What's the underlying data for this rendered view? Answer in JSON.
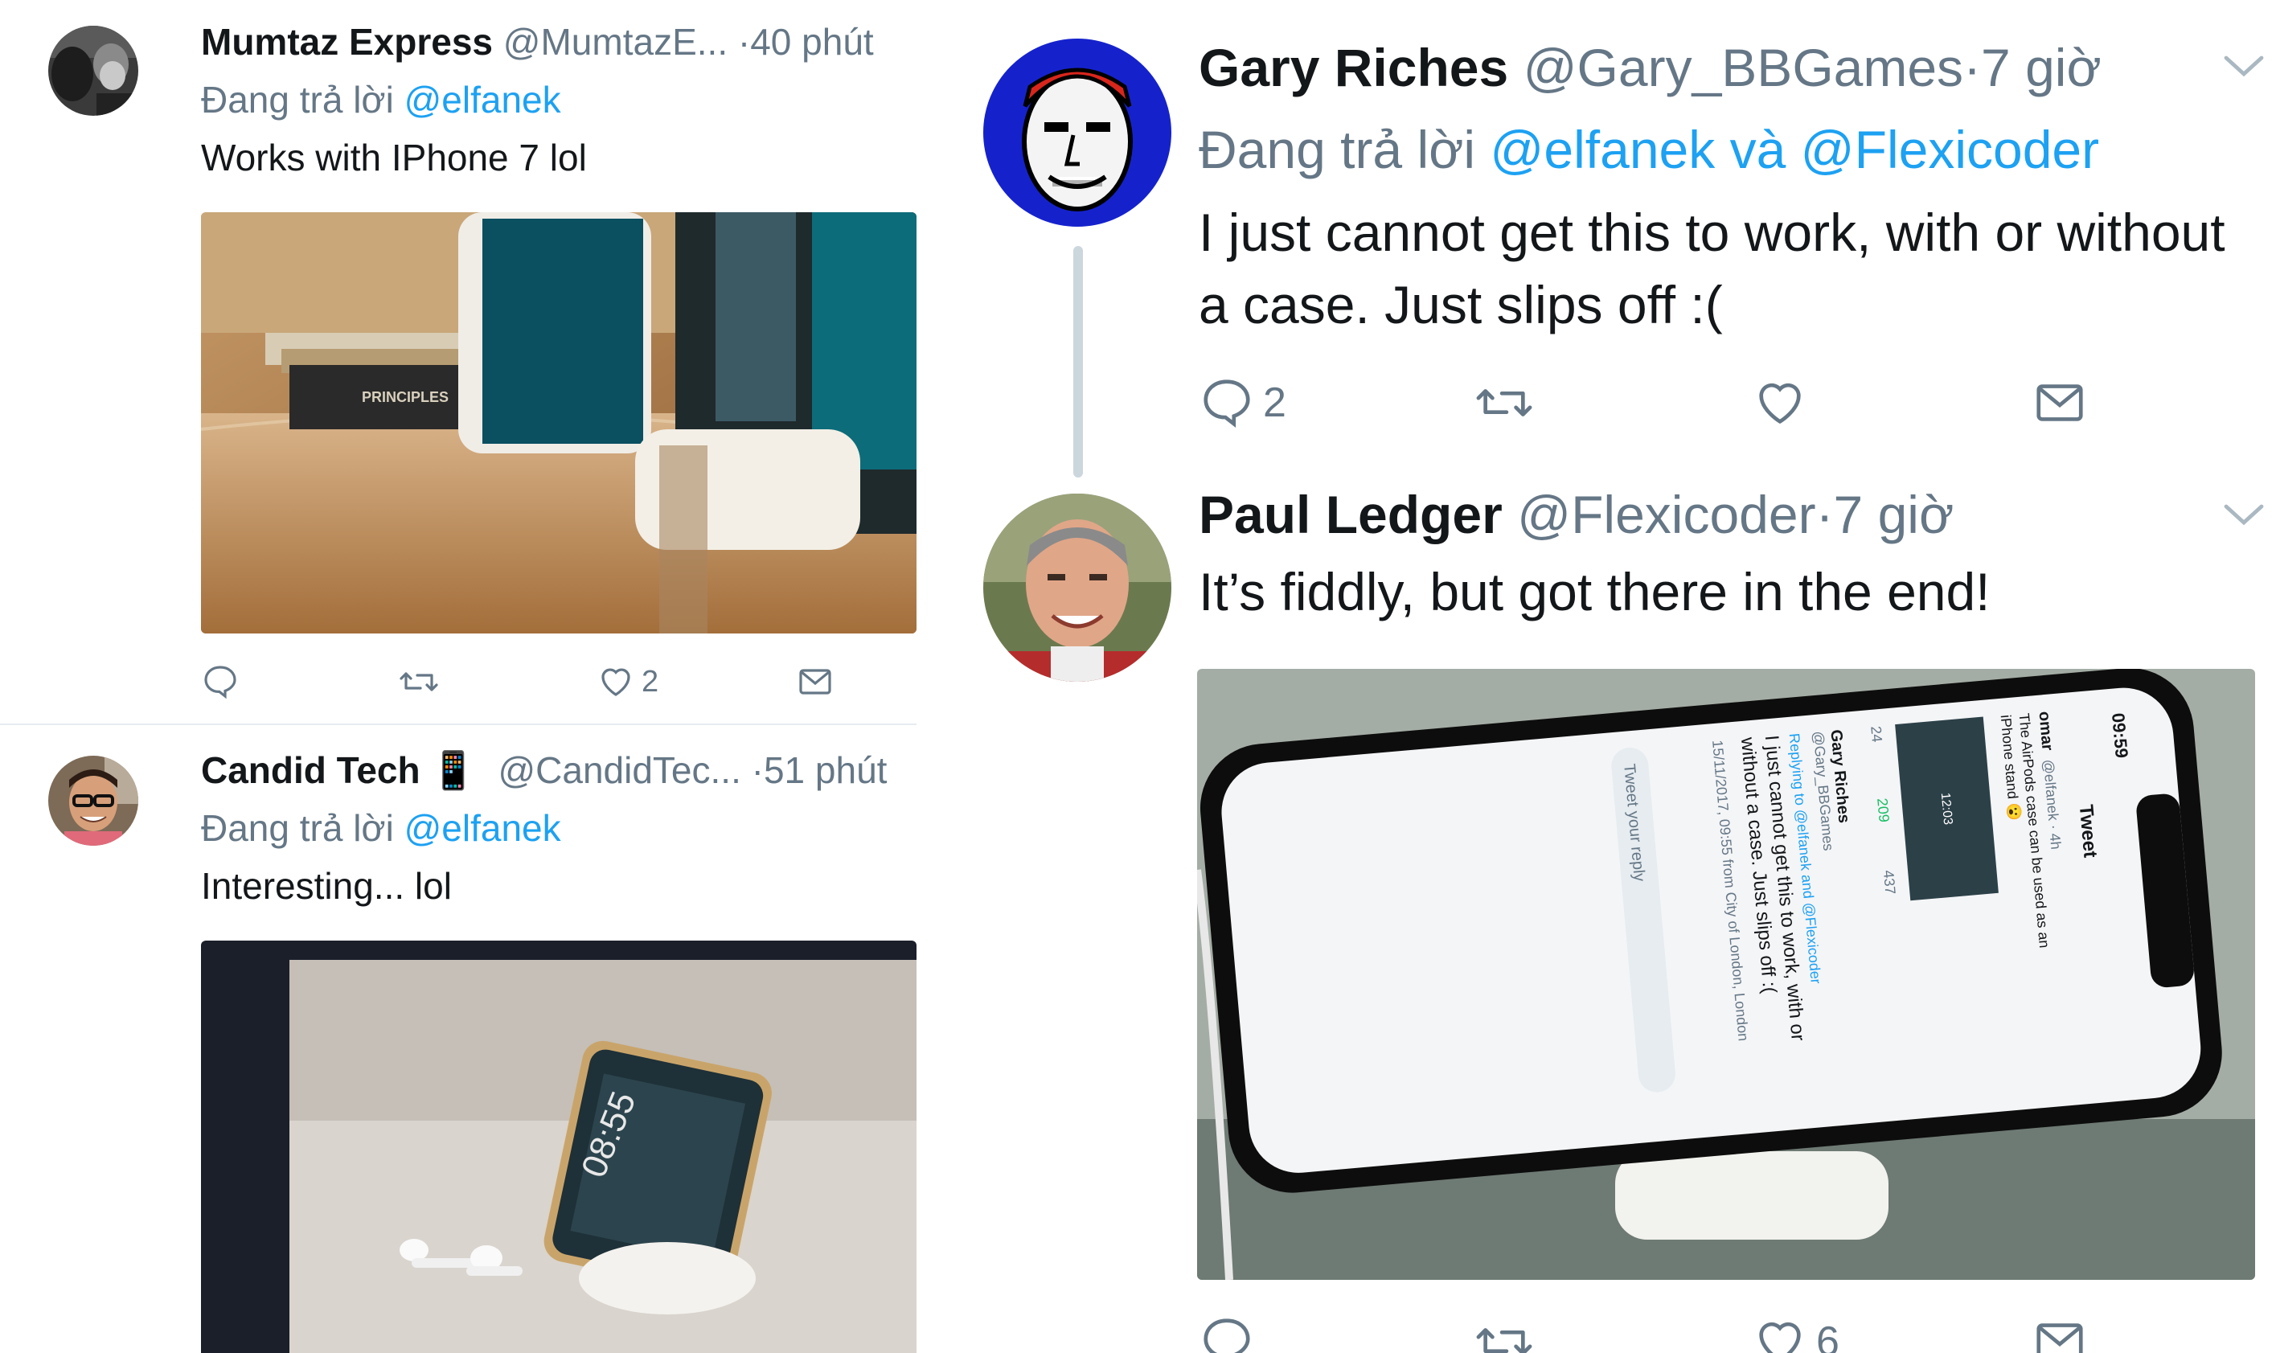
{
  "left_feed": {
    "tweets": [
      {
        "name": "Mumtaz Express",
        "handle": "@MumtazE...",
        "separator": "·",
        "time": "40 phút",
        "replying_prefix": "Đang trả lời ",
        "replying_to": "@elfanek",
        "text": "Works with IPhone 7 lol",
        "media_alt": "iPhone 7 standing on AirPods case next to books",
        "book_title": "PRINCIPLES",
        "actions": {
          "reply_count": "",
          "retweet_count": "",
          "like_count": "2"
        }
      },
      {
        "name": "Candid Tech",
        "name_emoji": "📱",
        "handle": "@CandidTec...",
        "separator": "·",
        "time": "51 phút",
        "replying_prefix": "Đang trả lời ",
        "replying_to": "@elfanek",
        "text": "Interesting... lol",
        "media_alt": "iPhone X standing on AirPods case with AirPods on table",
        "phone_clock": "08:55"
      }
    ]
  },
  "right_thread": {
    "tweets": [
      {
        "name": "Gary Riches",
        "handle": "@Gary_BBGames",
        "separator": "·",
        "time": "7 giờ",
        "replying_prefix": "Đang trả lời ",
        "replying_to_1": "@elfanek",
        "replying_and": " và ",
        "replying_to_2": "@Flexicoder",
        "text": "I just cannot get this to work, with or without a case. Just slips off :(",
        "actions": {
          "reply_count": "2",
          "retweet_count": "",
          "like_count": ""
        }
      },
      {
        "name": "Paul Ledger",
        "handle": "@Flexicoder",
        "separator": "·",
        "time": "7 giờ",
        "text": "It’s fiddly, but got there in the end!",
        "media_alt": "iPhone X on AirPods case showing tweet screen",
        "screen": {
          "status_time": "09:59",
          "title": "Tweet",
          "omar_name": "omar",
          "omar_handle": "@elfanek · 4h",
          "omar_text_1": "The AirPods case can be used as an",
          "omar_text_2": "iPhone stand 😮",
          "inner_clock": "12:03",
          "reply_count": "24",
          "retweet_count": "209",
          "like_count": "437",
          "gary_name": "Gary Riches",
          "gary_handle": "@Gary_BBGames",
          "replying_line": "Replying to @elfanek and @Flexicoder",
          "reply_text_1": "I just cannot get this to work, with or",
          "reply_text_2": "without a case. Just slips off :(",
          "meta": "15/11/2017, 09:55 from City of London, London",
          "compose_placeholder": "Tweet your reply"
        },
        "actions": {
          "reply_count": "",
          "retweet_count": "",
          "like_count": "6"
        }
      }
    ]
  },
  "colors": {
    "link": "#1da1f2",
    "muted": "#657786",
    "divider": "#e6ecf0"
  }
}
